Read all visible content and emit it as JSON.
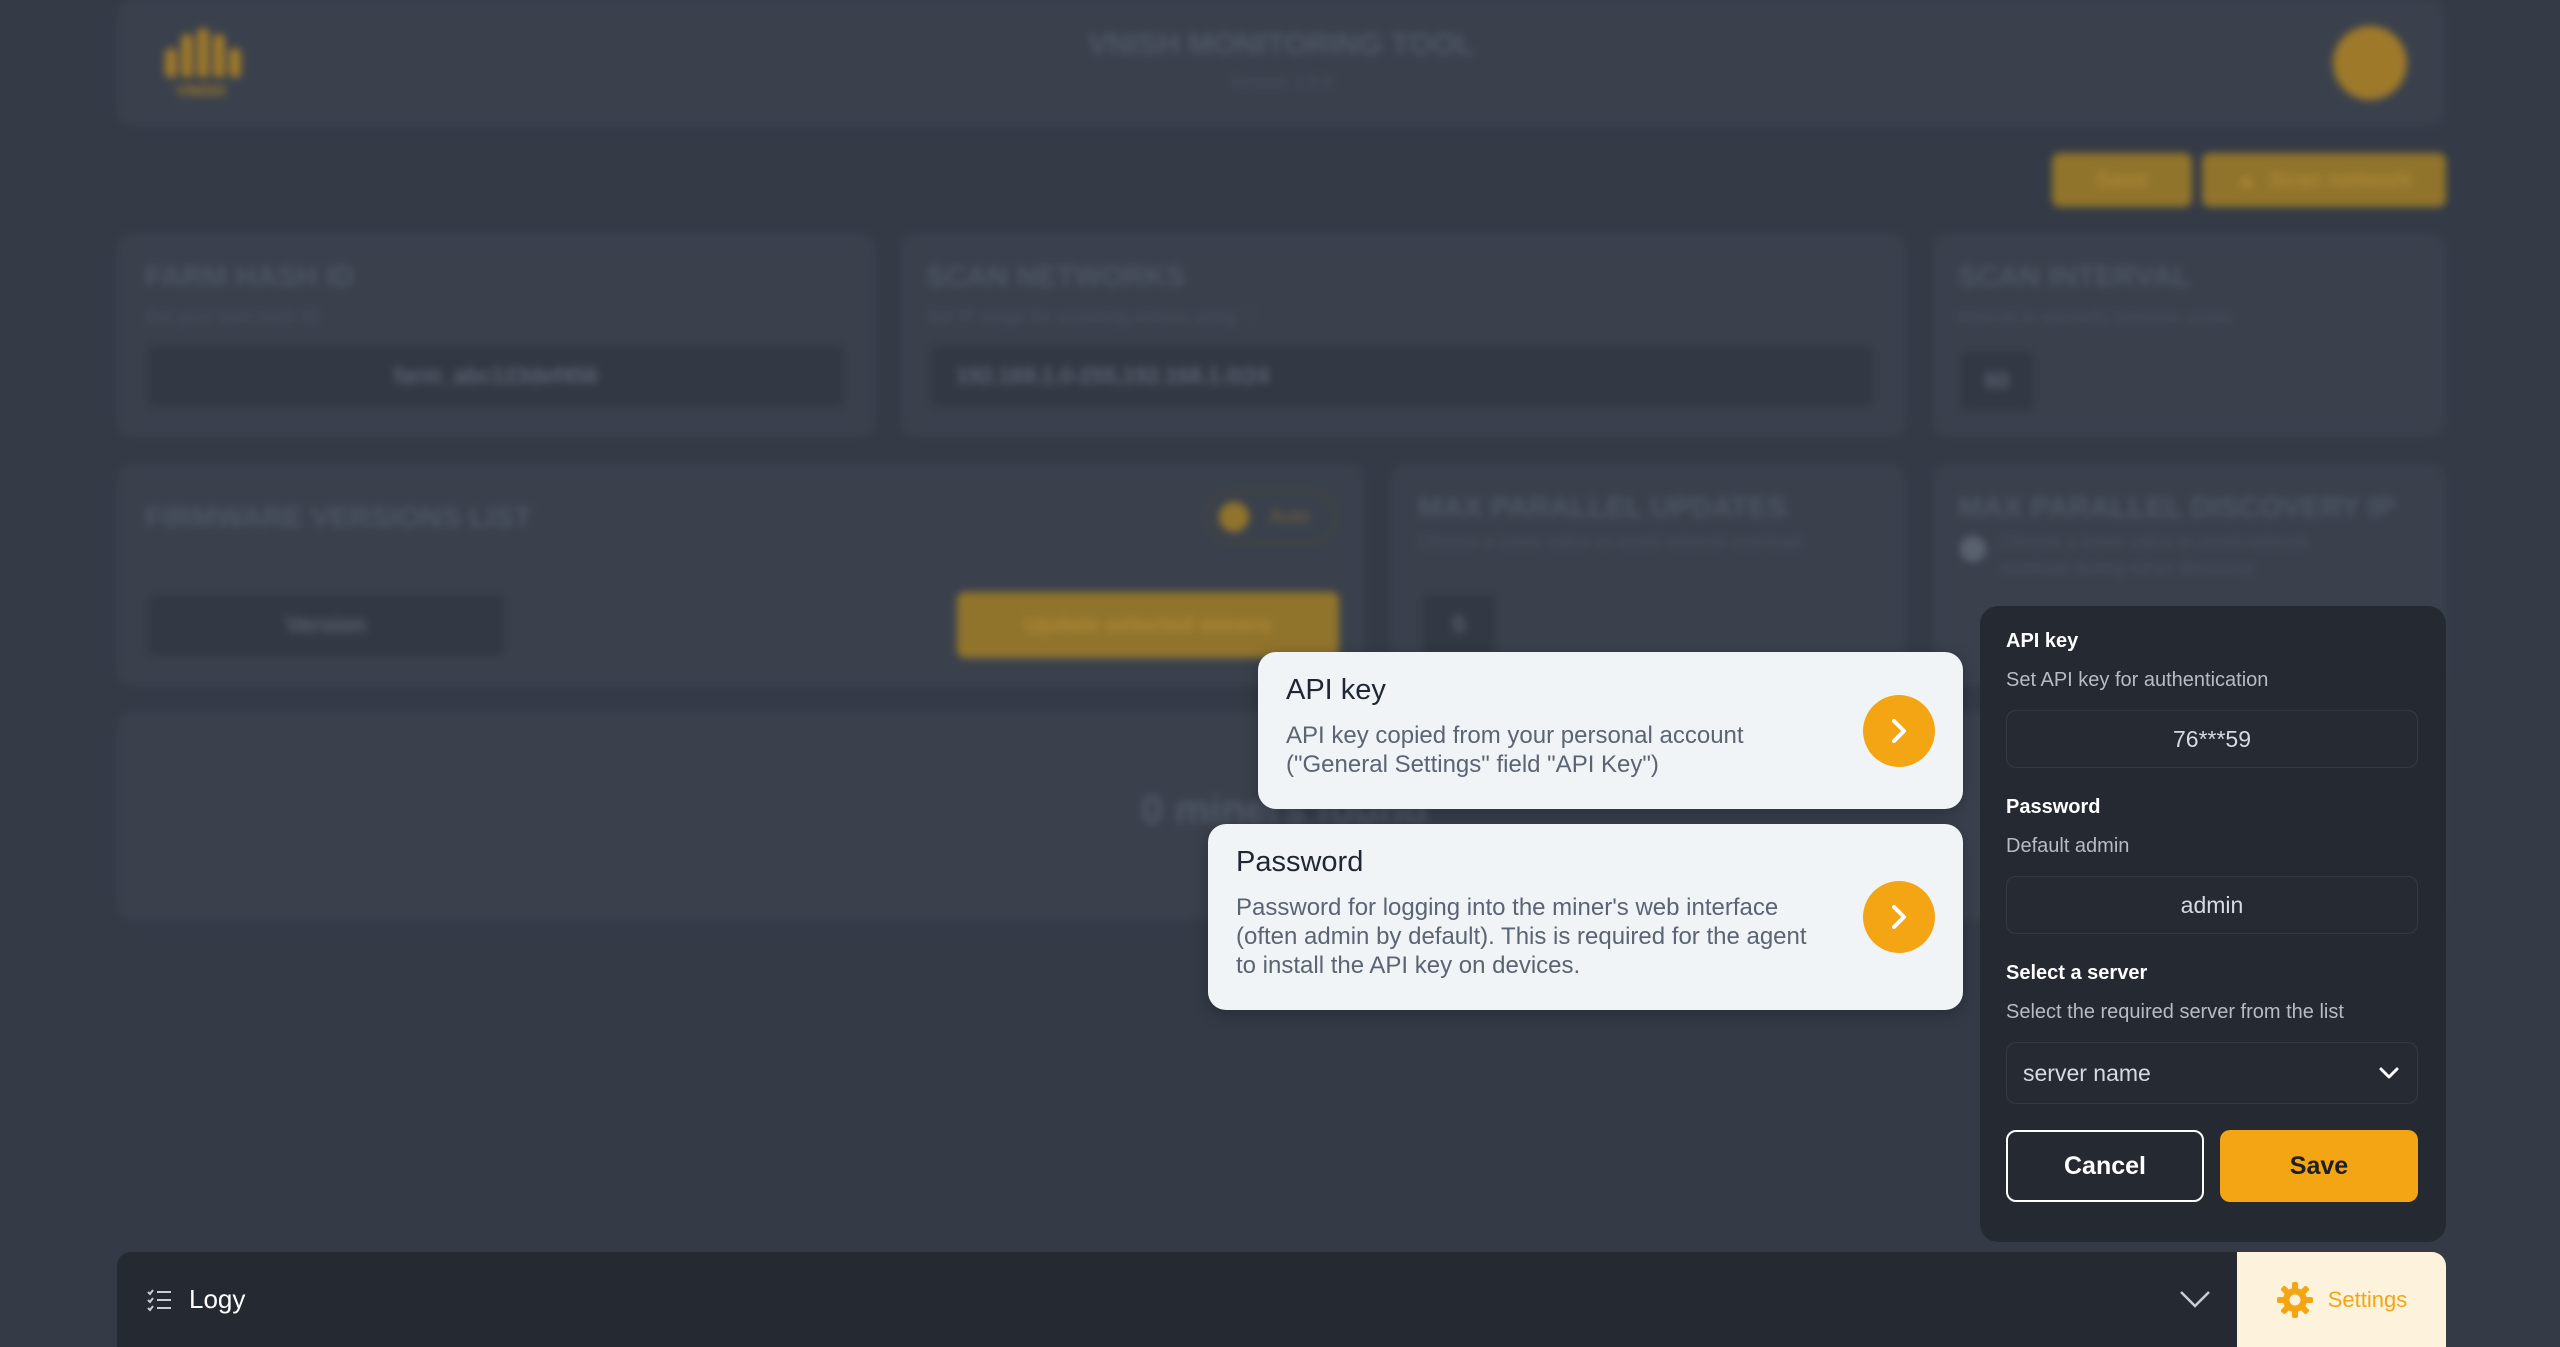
{
  "app": {
    "title": "VNISH MONITORING TOOL",
    "version": "Version 1.0.0",
    "logo_text": "VNISH",
    "top_save": "Save",
    "scan_network": "Scan network"
  },
  "cards": {
    "farm_hash": {
      "title": "FARM HASH ID",
      "subtitle": "Set your farm hash ID",
      "value": "farm_abc123def456"
    },
    "scan_networks": {
      "title": "SCAN NETWORKS",
      "subtitle": "Set IP range for scanning miners using \",\"",
      "value": "192.168.1.0-255,192.168.1.0/24"
    },
    "scan_interval": {
      "title": "SCAN INTERVAL",
      "subtitle": "Interval in seconds between scans",
      "value": "60"
    },
    "firmware": {
      "title": "FIRMWARE VERSIONS LIST",
      "auto": "Auto",
      "version": "Version",
      "update_button": "Update selected miners"
    },
    "max_updates": {
      "title": "MAX PARALLEL UPDATES",
      "subtitle": "Choose a lower value to avoid network overload",
      "value": "5"
    },
    "max_discovery": {
      "title": "MAX PARALLEL DISCOVERY IP",
      "subtitle_line1": "Choose a lower value to avoid network",
      "subtitle_line2": "overload during miner discovery"
    },
    "miners": {
      "empty": "0 miners found"
    }
  },
  "tooltips": {
    "api_key": {
      "title": "API key",
      "line1": "API key copied from your personal account",
      "line2": "(\"General Settings\" field \"API Key\")"
    },
    "password": {
      "title": "Password",
      "line1": "Password for logging into the miner's web interface",
      "line2": "(often admin by default). This is required for the agent",
      "line3": "to install the API key on devices."
    }
  },
  "settings_panel": {
    "api_key_label": "API key",
    "api_key_hint": "Set API key for authentication",
    "api_key_value": "76***59",
    "password_label": "Password",
    "password_hint": "Default admin",
    "password_value": "admin",
    "server_label": "Select a server",
    "server_hint": "Select the required server from the list",
    "server_value": "server name",
    "cancel": "Cancel",
    "save": "Save"
  },
  "bottom": {
    "logs_label": "Logy",
    "settings_label": "Settings"
  },
  "colors": {
    "accent": "#f3a513",
    "background": "#3b4350",
    "panel": "#252a32"
  },
  "icons": [
    "vnish-logo",
    "avatar-icon",
    "rocket-icon",
    "chevron-right-icon",
    "chevron-down-icon",
    "list-icon",
    "gear-icon"
  ]
}
